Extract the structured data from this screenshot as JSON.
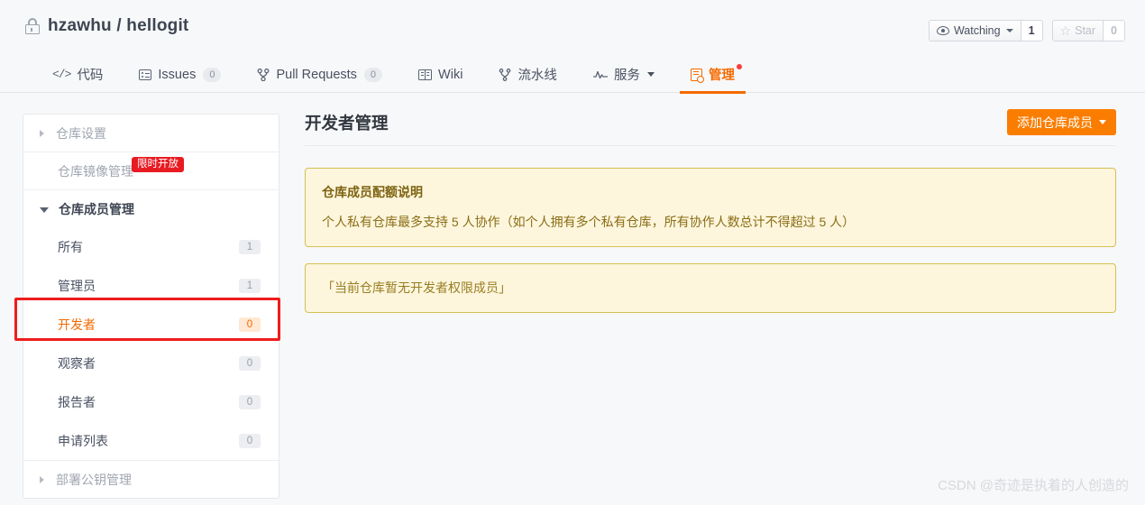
{
  "header": {
    "lock_icon": "lock-icon",
    "owner": "hzawhu",
    "separator": "/",
    "repo": "hellogit",
    "title_full": "hzawhu / hellogit",
    "watch": {
      "icon": "eye-icon",
      "label": "Watching",
      "count": "1"
    },
    "star": {
      "icon": "star-icon",
      "label": "Star",
      "count": "0"
    }
  },
  "nav": {
    "tabs": [
      {
        "label": "代码",
        "icon": "code-icon",
        "count": null,
        "active": false
      },
      {
        "label": "Issues",
        "icon": "issue-list-icon",
        "count": "0",
        "active": false
      },
      {
        "label": "Pull Requests",
        "icon": "git-pull-request-icon",
        "count": "0",
        "active": false
      },
      {
        "label": "Wiki",
        "icon": "book-icon",
        "count": null,
        "active": false
      },
      {
        "label": "流水线",
        "icon": "pipeline-icon",
        "count": null,
        "active": false
      },
      {
        "label": "服务",
        "icon": "activity-icon",
        "count": null,
        "active": false,
        "has_caret": true
      },
      {
        "label": "管理",
        "icon": "admin-gear-icon",
        "count": null,
        "active": true,
        "has_dot": true
      }
    ]
  },
  "sidebar": {
    "groups": [
      {
        "label": "仓库设置",
        "type": "collapsed",
        "icon": "triangle-right-icon"
      },
      {
        "label": "仓库镜像管理",
        "type": "plain",
        "badge": "限时开放"
      },
      {
        "label": "仓库成员管理",
        "type": "expanded",
        "icon": "triangle-down-icon",
        "items": [
          {
            "label": "所有",
            "count": "1",
            "active": false
          },
          {
            "label": "管理员",
            "count": "1",
            "active": false
          },
          {
            "label": "开发者",
            "count": "0",
            "active": true
          },
          {
            "label": "观察者",
            "count": "0",
            "active": false
          },
          {
            "label": "报告者",
            "count": "0",
            "active": false
          },
          {
            "label": "申请列表",
            "count": "0",
            "active": false
          }
        ]
      },
      {
        "label": "部署公钥管理",
        "type": "collapsed",
        "icon": "triangle-right-icon"
      }
    ]
  },
  "main": {
    "page_title": "开发者管理",
    "add_member_button": "添加仓库成员",
    "quota_alert": {
      "title": "仓库成员配额说明",
      "body": "个人私有仓库最多支持 5 人协作（如个人拥有多个私有仓库，所有协作人数总计不得超过 5 人）"
    },
    "empty_alert": {
      "body": "「当前仓库暂无开发者权限成员」"
    }
  },
  "watermark": "CSDN @奇迹是执着的人创造的",
  "colors": {
    "accent": "#f56a00",
    "primary_button": "#fa7d00",
    "annotation": "#ef1c1c",
    "badge_red": "#e81b23",
    "alert_bg": "#fdf6dd",
    "alert_border": "#d6bf53",
    "page_bg": "#f7f8f9"
  }
}
